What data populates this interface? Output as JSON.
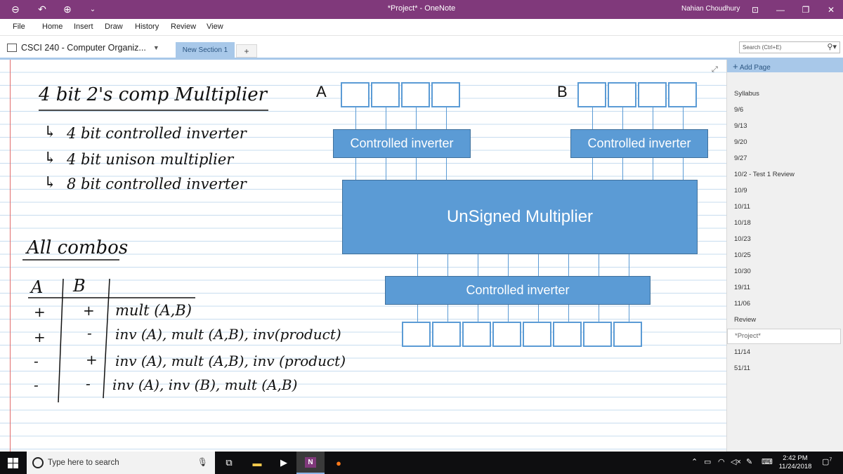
{
  "window": {
    "title": "*Project* - OneNote",
    "user": "Nahian Choudhury"
  },
  "menu": [
    "File",
    "Home",
    "Insert",
    "Draw",
    "History",
    "Review",
    "View"
  ],
  "notebook": {
    "name": "CSCI 240 - Computer Organiz...",
    "section": "New Section 1",
    "add_section": "+"
  },
  "search": {
    "placeholder": "Search (Ctrl+E)"
  },
  "notes": {
    "title": "4 bit 2's comp Multiplier",
    "bullets": [
      "4 bit controlled inverter",
      "4 bit unison multiplier",
      "8 bit controlled inverter"
    ],
    "combos_title": "All combos",
    "table_headers": [
      "A",
      "B"
    ],
    "rows": [
      [
        "+",
        "+",
        "mult (A,B)"
      ],
      [
        "+",
        "-",
        "inv (A), mult (A,B), inv(product)"
      ],
      [
        "-",
        "+",
        "inv (A), mult (A,B), inv (product)"
      ],
      [
        "-",
        "-",
        "inv (A), inv (B), mult (A,B)"
      ]
    ]
  },
  "diagram": {
    "label_a": "A",
    "label_b": "B",
    "inverter_a": "Controlled inverter",
    "inverter_b": "Controlled inverter",
    "multiplier": "UnSigned Multiplier",
    "inverter_out": "Controlled inverter"
  },
  "pages_panel": {
    "add_page": "Add Page",
    "pages": [
      "Syllabus",
      "9/6",
      "9/13",
      "9/20",
      "9/27",
      "10/2 - Test 1 Review",
      "10/9",
      "10/11",
      "10/18",
      "10/23",
      "10/25",
      "10/30",
      "19/11",
      "11/06",
      "Review",
      "*Project*",
      "11/14",
      "51/11"
    ],
    "active_index": 15
  },
  "taskbar": {
    "search_placeholder": "Type here to search",
    "time": "2:42 PM",
    "date": "11/24/2018",
    "notifications": "7"
  }
}
